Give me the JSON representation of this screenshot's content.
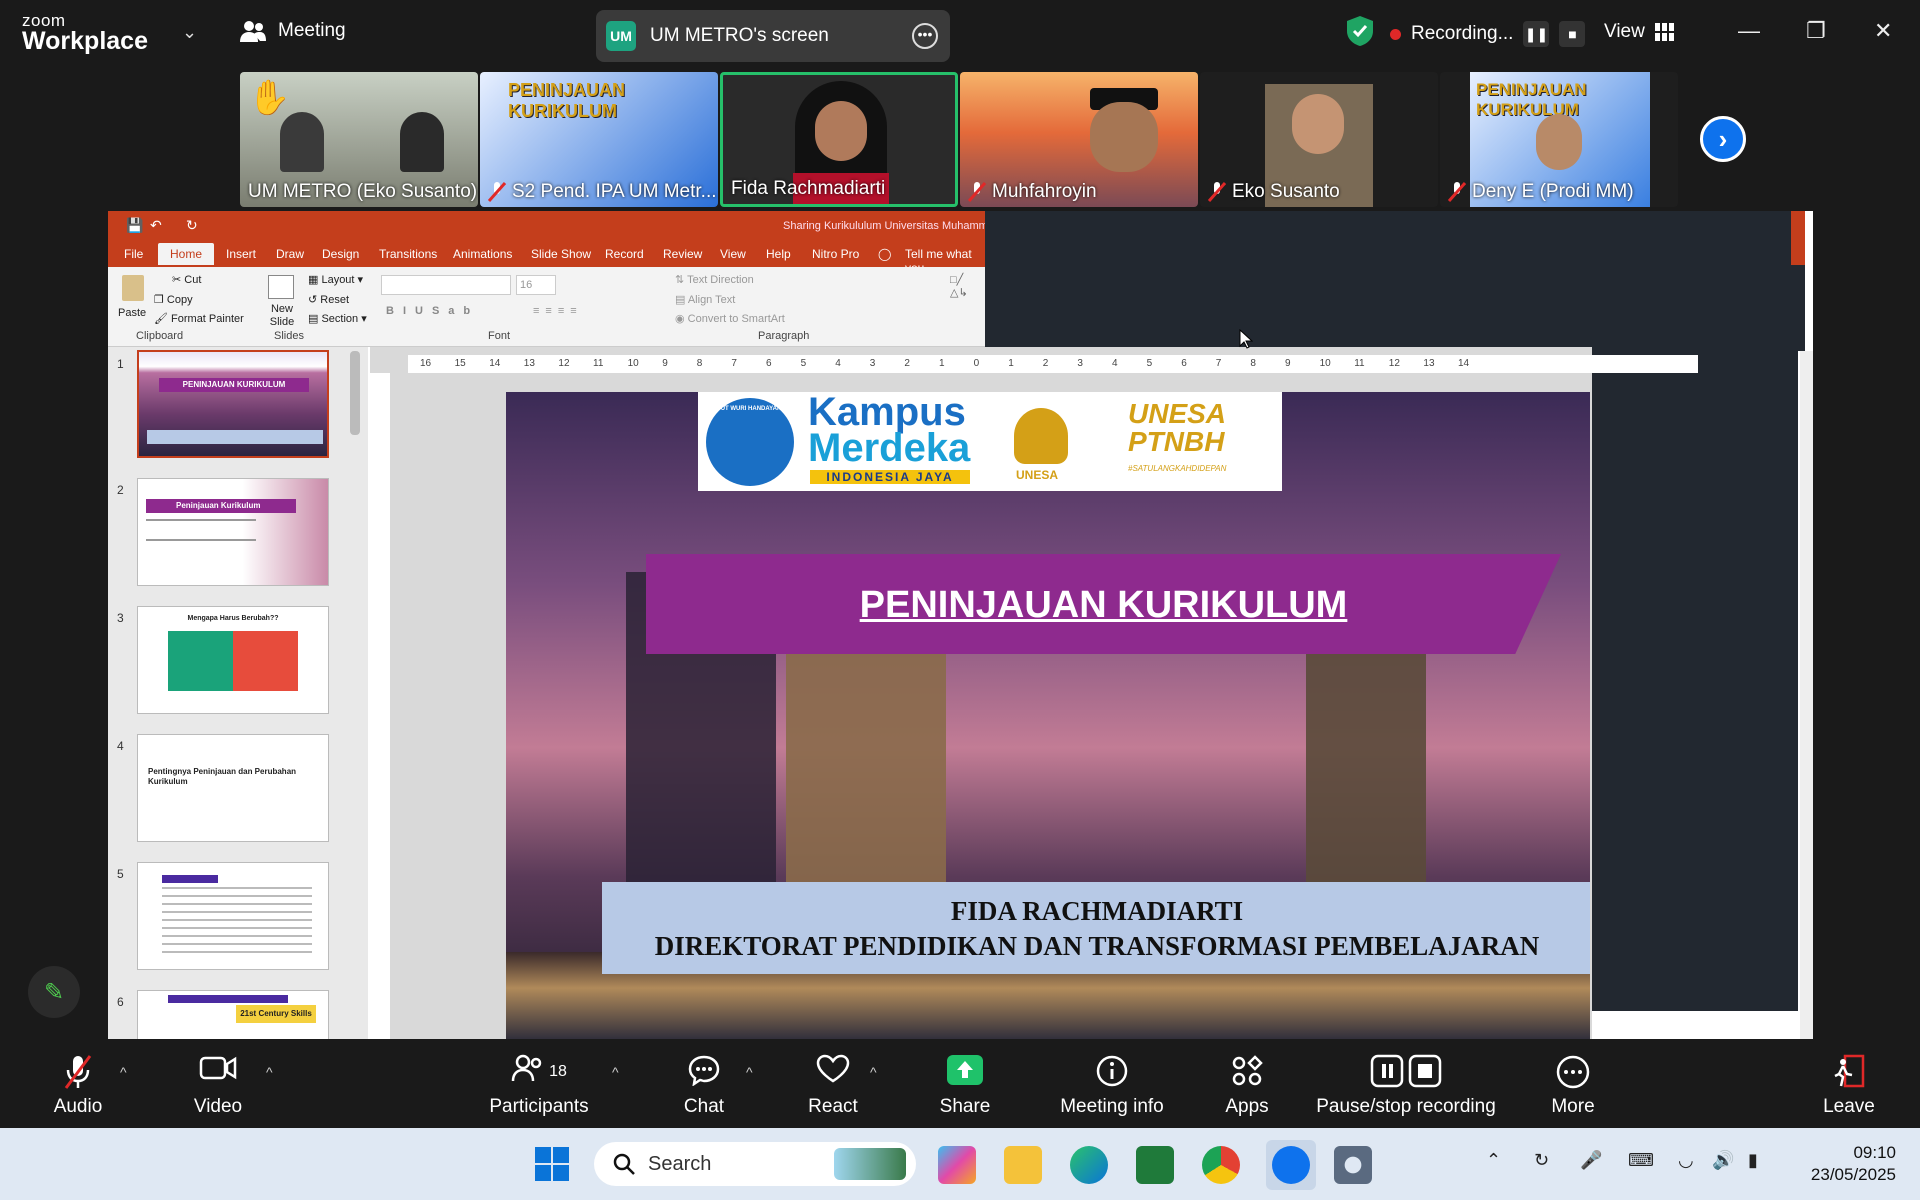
{
  "zoom": {
    "logo_line1": "zoom",
    "logo_line2": "Workplace",
    "meeting_label": "Meeting",
    "screen_share_initials": "UM",
    "screen_share_label": "UM METRO's screen",
    "recording_label": "Recording...",
    "view_label": "View",
    "accent": "#0e72ed"
  },
  "participants": [
    {
      "name": "UM METRO (Eko Susanto)",
      "muted": false
    },
    {
      "name": "S2 Pend. IPA UM Metr...",
      "muted": true
    },
    {
      "name": "Fida Rachmadiarti",
      "muted": false
    },
    {
      "name": "Muhfahroyin",
      "muted": true
    },
    {
      "name": "Eko Susanto",
      "muted": true
    },
    {
      "name": "Deny E (Prodi MM)",
      "muted": true
    }
  ],
  "thumb_banner_text": "PENINJAUAN KURIKULUM",
  "powerpoint": {
    "window_title": "Sharing Kurikululum Universitas Muhamma",
    "tabs": [
      "File",
      "Home",
      "Insert",
      "Draw",
      "Design",
      "Transitions",
      "Animations",
      "Slide Show",
      "Record",
      "Review",
      "View",
      "Help",
      "Nitro Pro"
    ],
    "tell_me": "Tell me what you",
    "ribbon": {
      "paste": "Paste",
      "cut": "Cut",
      "copy": "Copy",
      "format_painter": "Format Painter",
      "new_slide": "New Slide",
      "layout": "Layout",
      "reset": "Reset",
      "section": "Section",
      "font_size": "16",
      "text_direction": "Text Direction",
      "align_text": "Align Text",
      "convert_smartart": "Convert to SmartArt",
      "groups": [
        "Clipboard",
        "Slides",
        "Font",
        "Paragraph"
      ]
    },
    "slides": [
      {
        "num": "1",
        "title": "PENINJAUAN KURIKULUM"
      },
      {
        "num": "2",
        "title": "Peninjauan Kurikulum"
      },
      {
        "num": "3",
        "title": "Mengapa Harus Berubah??"
      },
      {
        "num": "4",
        "title": "Pentingnya Peninjauan dan Perubahan Kurikulum"
      },
      {
        "num": "5",
        "title": ""
      },
      {
        "num": "6",
        "title": "21st Century Skills"
      }
    ],
    "ruler_numbers": [
      "16",
      "15",
      "14",
      "13",
      "12",
      "11",
      "10",
      "9",
      "8",
      "7",
      "6",
      "5",
      "4",
      "3",
      "2",
      "1",
      "0",
      "1",
      "2",
      "3",
      "4",
      "5",
      "6",
      "7",
      "8",
      "9",
      "10",
      "11",
      "12",
      "13",
      "14"
    ]
  },
  "slide": {
    "logo_kampus_1": "Kampus",
    "logo_kampus_2": "Merdeka",
    "logo_tagline": "INDONESIA JAYA",
    "logo_unesa": "UNESA",
    "logo_ptnbh_1": "UNESA",
    "logo_ptnbh_2": "PTNBH",
    "logo_ptnbh_3": "#SATULANGKAHDIDEPAN",
    "logo_tut": "TUT WURI HANDAYANI",
    "title": "PENINJAUAN KURIKULUM",
    "presenter": "FIDA RACHMADIARTI",
    "directorate": "DIREKTORAT PENDIDIKAN DAN TRANSFORMASI PEMBELAJARAN"
  },
  "toolbar": {
    "audio": "Audio",
    "video": "Video",
    "participants": "Participants",
    "participant_count": "18",
    "chat": "Chat",
    "react": "React",
    "share": "Share",
    "meeting_info": "Meeting info",
    "apps": "Apps",
    "pause_recording": "Pause/stop recording",
    "more": "More",
    "leave": "Leave"
  },
  "taskbar": {
    "search_placeholder": "Search",
    "time": "09:10",
    "date": "23/05/2025"
  }
}
